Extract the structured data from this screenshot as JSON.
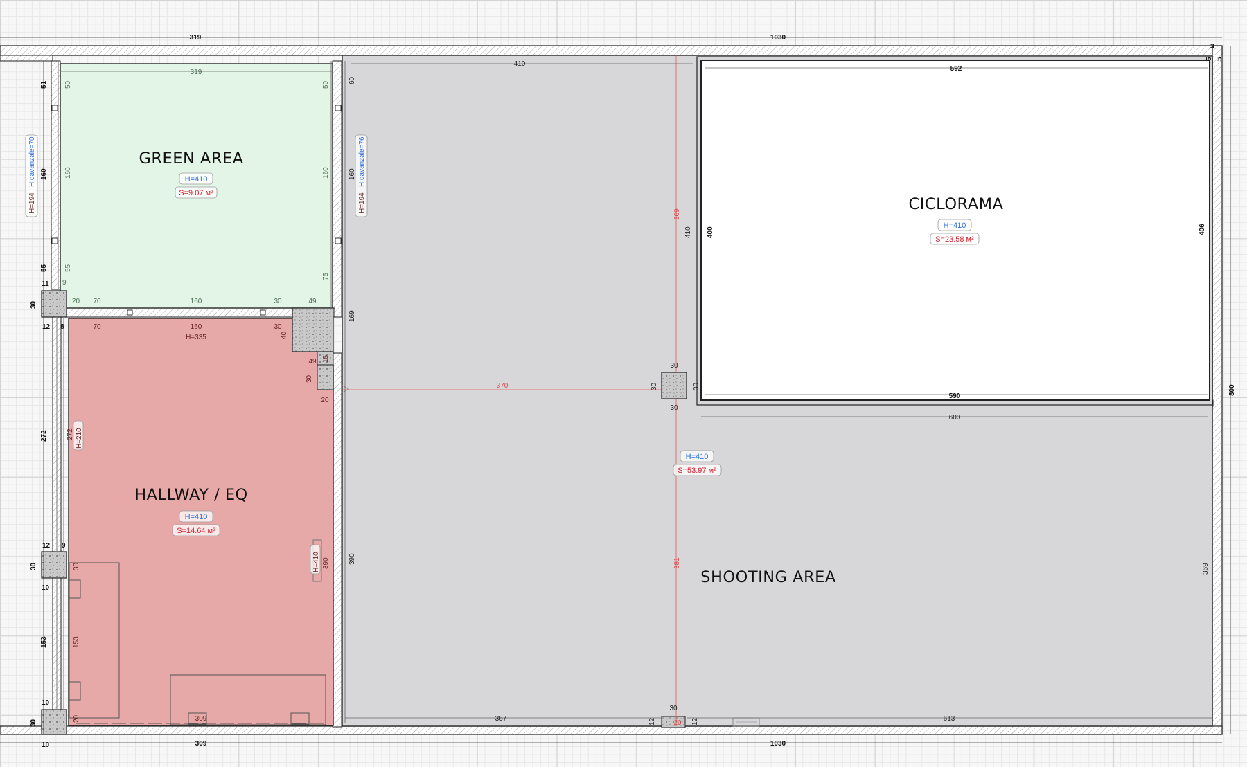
{
  "rooms": {
    "green_area": {
      "name": "GREEN AREA",
      "height": "H=410",
      "area": "S=9.07 м²"
    },
    "ciclorama": {
      "name": "CICLORAMA",
      "height": "H=410",
      "area": "S=23.58 м²"
    },
    "hallway": {
      "name": "HALLWAY / EQ",
      "height": "H=410",
      "area": "S=14.64 м²"
    },
    "shooting": {
      "name": "SHOOTING AREA",
      "height": "H=410",
      "area": "S=53.97 м²"
    }
  },
  "dimensions": {
    "top_left_outer": "319",
    "top_right_outer": "1030",
    "green_top": "319",
    "green_side_top": "50",
    "green_side_mid": "160",
    "green_side_bottom": "55",
    "green_side_right_bottom": "75",
    "green_bottom_a": "70",
    "green_bottom_b": "160",
    "green_bottom_c": "30",
    "green_bottom_d": "49",
    "green_bottom_e": "20",
    "green_corner_9": "9",
    "left_51": "51",
    "left_160": "160",
    "left_55": "55",
    "left_11": "11",
    "left_30a": "30",
    "left_12a": "12",
    "left_8": "8",
    "hall_top_a": "70",
    "hall_top_b": "160",
    "hall_top_c": "30",
    "hall_h335": "H=335",
    "hall_40": "40",
    "hall_49": "49",
    "hall_15": "15",
    "hall_30": "30",
    "hall_20": "20",
    "left_272": "272",
    "hall_272": "272",
    "hall_h210": "H=210",
    "left_12b": "12",
    "left_9b": "9",
    "left_30b": "30",
    "left_10b": "10",
    "hall_30b": "30",
    "left_153": "153",
    "hall_153": "153",
    "left_10c": "10",
    "left_30c": "30",
    "left_10d": "10",
    "hall_20b": "20",
    "hall_309": "309",
    "hall_h410": "H=410",
    "hall_390": "390",
    "bottom_309": "309",
    "shoot_410_top": "410",
    "shoot_60": "60",
    "shoot_160": "160",
    "shoot_169": "169",
    "shoot_390": "390",
    "shoot_370": "370",
    "shoot_369_red": "369",
    "shoot_410_side": "410",
    "shoot_381_red": "381",
    "shoot_367": "367",
    "shoot_613": "613",
    "shoot_369_right": "369",
    "col_30_top": "30",
    "col_30_left": "30",
    "col_30_right": "30",
    "col_30_bottom": "30",
    "bottom_col_30": "30",
    "bottom_col_12a": "12",
    "bottom_col_12b": "12",
    "bottom_col_20": "20",
    "cyc_592": "592",
    "cyc_400": "400",
    "cyc_406": "406",
    "cyc_590": "590",
    "cyc_600": "600",
    "right_800": "800",
    "right_3": "3",
    "right_5a": "5",
    "right_5b": "5",
    "bottom_1030": "1030",
    "win_left_h194": "H=194",
    "win_left_sill": "H davanzale=70",
    "win_right_h194": "H=194",
    "win_right_sill": "H davanzale=76"
  },
  "colors": {
    "green_room": "#e3f5e6",
    "hall_room": "#e6a9a8",
    "shooting_room": "#d7d7d9",
    "ciclorama_room": "#ffffff",
    "red_measure": "#e05555",
    "blue_text": "#2f6fd6"
  }
}
